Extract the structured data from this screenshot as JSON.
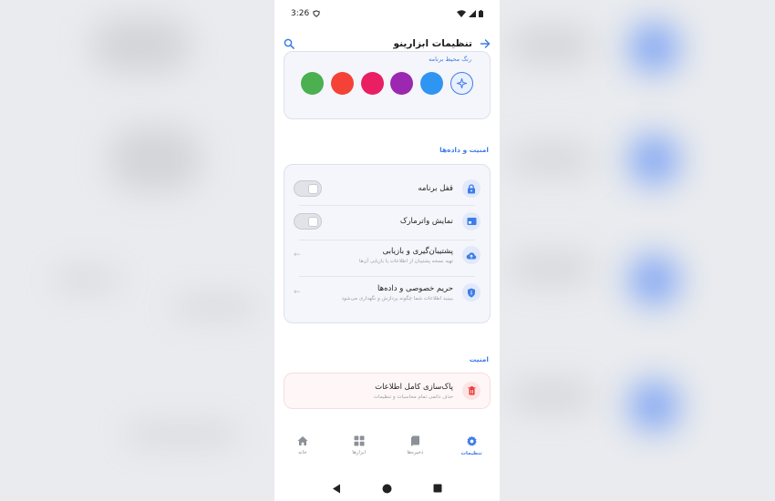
{
  "status": {
    "time": "3:26"
  },
  "appbar": {
    "title": "تنظیمات ابزارینو"
  },
  "theme": {
    "label": "رنگ محیط برنامه",
    "swatches": [
      "#3f7de6",
      "#2f95f2",
      "#9c27b0",
      "#e91e63",
      "#f44336",
      "#4caf50"
    ]
  },
  "security_data": {
    "title": "امنیت و داده‌ها",
    "items": [
      {
        "title": "قفل برنامه",
        "icon": "lock-icon"
      },
      {
        "title": "نمایش واترمارک",
        "icon": "watermark-icon"
      },
      {
        "title": "پشتیبان‌گیری و بازیابی",
        "subtitle": "تهیه نسخه پشتیبان از اطلاعات یا بازیابی آن‌ها",
        "icon": "cloud-upload-icon"
      },
      {
        "title": "حریم خصوصی و داده‌ها",
        "subtitle": "ببینید اطلاعات شما چگونه پردازش و نگهداری می‌شود",
        "icon": "shield-icon"
      }
    ]
  },
  "danger": {
    "title": "امنیت",
    "item_title": "پاک‌سازی کامل اطلاعات",
    "item_subtitle": "حذف دائمی تمام محاسبات و تنظیمات"
  },
  "nav": {
    "items": [
      "تنظیمات",
      "ذخیره‌ها",
      "ابزارها",
      "خانه"
    ]
  },
  "colors": {
    "accent": "#3f7de6",
    "danger": "#e53935"
  }
}
